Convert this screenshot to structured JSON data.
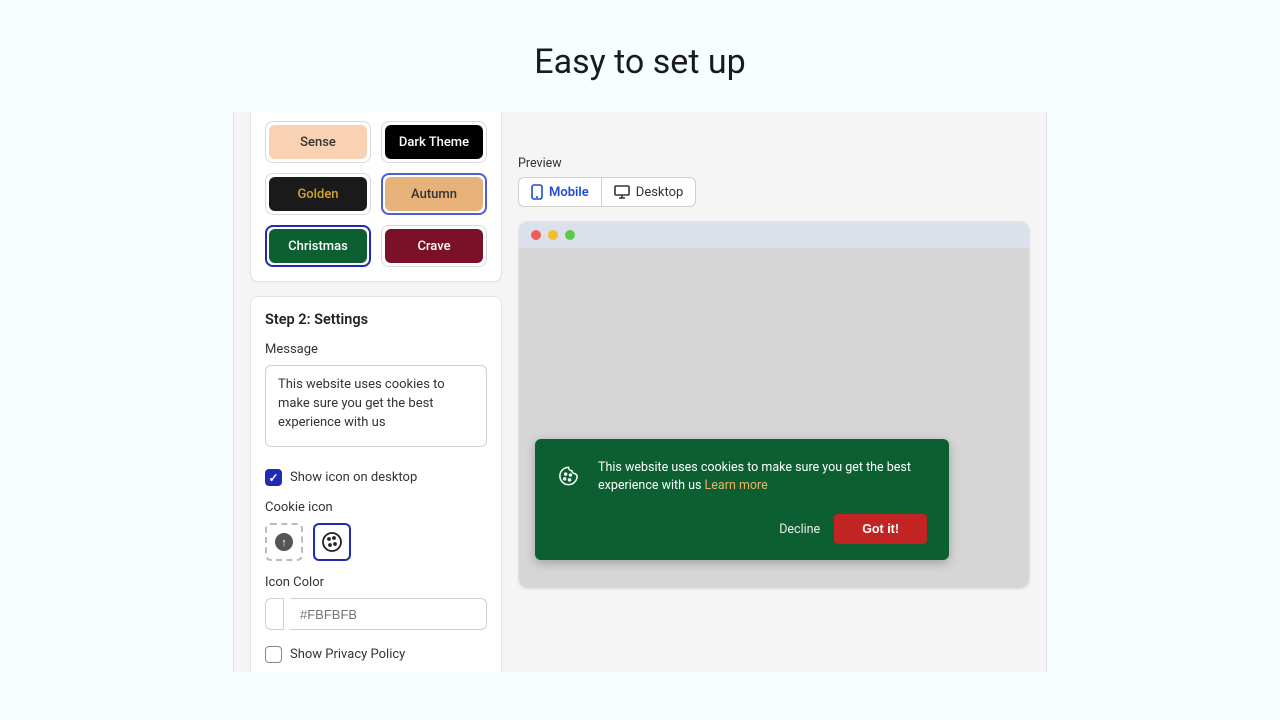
{
  "page": {
    "title": "Easy to set up"
  },
  "themes": {
    "sense": "Sense",
    "dark": "Dark Theme",
    "golden": "Golden",
    "autumn": "Autumn",
    "christmas": "Christmas",
    "crave": "Crave"
  },
  "step2": {
    "title": "Step 2: Settings",
    "message_label": "Message",
    "message_value": "This website uses cookies to make sure you get the best experience with us",
    "show_icon_label": "Show icon on desktop",
    "cookie_icon_label": "Cookie icon",
    "icon_color_label": "Icon Color",
    "icon_color_placeholder": "#FBFBFB",
    "show_privacy_label": "Show Privacy Policy"
  },
  "preview": {
    "label": "Preview",
    "mobile": "Mobile",
    "desktop": "Desktop"
  },
  "banner": {
    "text": "This website uses cookies to make sure you get the best experience with us ",
    "learn_more": "Learn more",
    "decline": "Decline",
    "accept": "Got it!"
  }
}
